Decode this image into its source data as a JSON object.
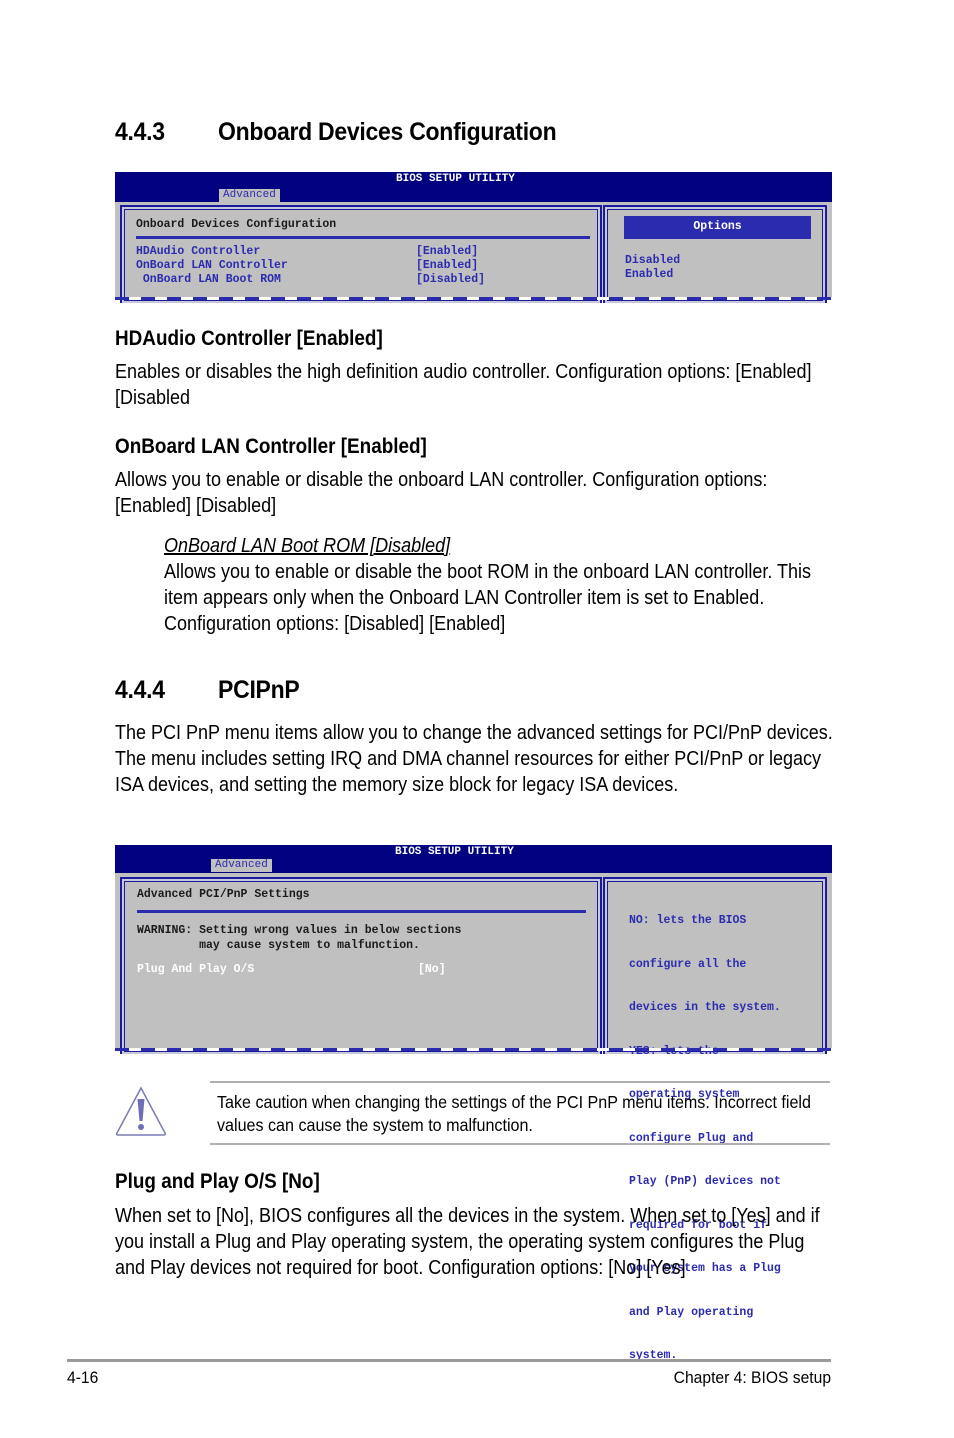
{
  "section_443": {
    "number": "4.4.3",
    "title": "Onboard Devices Configuration",
    "bios": {
      "utility_title": "BIOS SETUP UTILITY",
      "active_tab": "Advanced",
      "panel_title": "Onboard Devices Configuration",
      "items": [
        {
          "label": "HDAudio Controller",
          "value": "[Enabled]"
        },
        {
          "label": "OnBoard LAN Controller",
          "value": "[Enabled]"
        },
        {
          "label": " OnBoard LAN Boot ROM",
          "value": "[Disabled]"
        }
      ],
      "options_header": "Options",
      "options": [
        "Disabled",
        "Enabled"
      ]
    },
    "items": [
      {
        "heading": "HDAudio Controller [Enabled]",
        "body": "Enables or disables the high definition audio controller. Configuration options: [Enabled] [Disabled"
      },
      {
        "heading": "OnBoard LAN Controller [Enabled]",
        "body": "Allows you to enable or disable the onboard LAN controller. Configuration options: [Enabled] [Disabled]"
      }
    ],
    "subitem": {
      "heading": "OnBoard LAN Boot ROM [Disabled]",
      "body": "Allows you to enable or disable the boot ROM in the onboard LAN controller. This item appears only when the Onboard LAN Controller item is set to Enabled. Configuration options: [Disabled] [Enabled]"
    }
  },
  "section_444": {
    "number": "4.4.4",
    "title": "PCIPnP",
    "intro": "The PCI PnP menu items allow you to change the advanced settings for PCI/PnP devices. The menu includes setting IRQ and DMA channel resources for either PCI/PnP or legacy ISA devices, and setting the memory size block for legacy ISA devices.",
    "bios": {
      "utility_title": "BIOS SETUP UTILITY",
      "active_tab": "Advanced",
      "panel_title": "Advanced PCI/PnP Settings",
      "warning_line1": "WARNING: Setting wrong values in below sections",
      "warning_line2": "         may cause system to malfunction.",
      "items": [
        {
          "label": "Plug And Play O/S",
          "value": "[No]"
        }
      ],
      "help_lines": [
        "NO: lets the BIOS",
        "configure all the",
        "devices in the system.",
        "YES: lets the",
        "operating system",
        "configure Plug and",
        "Play (PnP) devices not",
        "required for boot if",
        "your system has a Plug",
        "and Play operating",
        "system."
      ]
    },
    "caution": {
      "icon": "warning-triangle-icon",
      "text": "Take caution when changing the settings of the PCI PnP menu items. Incorrect field values can cause the system to malfunction."
    },
    "items": [
      {
        "heading": "Plug and Play O/S [No]",
        "body": "When set to [No], BIOS configures all the devices in the system. When set to [Yes] and if you install a Plug and Play operating system, the operating system configures the Plug and Play devices not required for boot. Configuration options: [No] [Yes]"
      }
    ]
  },
  "footer": {
    "page_number": "4-16",
    "chapter": "Chapter 4: BIOS setup"
  }
}
